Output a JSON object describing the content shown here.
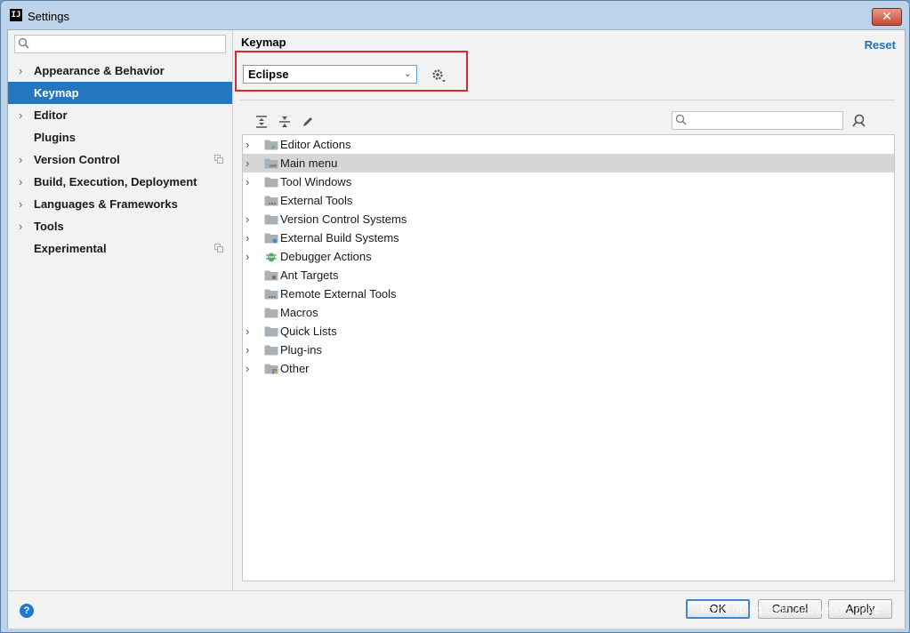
{
  "window": {
    "title": "Settings",
    "app_icon_text": "IJ",
    "close_glyph": "✕"
  },
  "sidebar": {
    "search": {
      "placeholder": "",
      "value": ""
    },
    "items": [
      {
        "label": "Appearance & Behavior",
        "expandable": true,
        "selected": false,
        "project_icon": false
      },
      {
        "label": "Keymap",
        "expandable": false,
        "selected": true,
        "project_icon": false
      },
      {
        "label": "Editor",
        "expandable": true,
        "selected": false,
        "project_icon": false
      },
      {
        "label": "Plugins",
        "expandable": false,
        "selected": false,
        "project_icon": false
      },
      {
        "label": "Version Control",
        "expandable": true,
        "selected": false,
        "project_icon": true
      },
      {
        "label": "Build, Execution, Deployment",
        "expandable": true,
        "selected": false,
        "project_icon": false
      },
      {
        "label": "Languages & Frameworks",
        "expandable": true,
        "selected": false,
        "project_icon": false
      },
      {
        "label": "Tools",
        "expandable": true,
        "selected": false,
        "project_icon": false
      },
      {
        "label": "Experimental",
        "expandable": false,
        "selected": false,
        "project_icon": true
      }
    ]
  },
  "main": {
    "breadcrumb": "Keymap",
    "reset_label": "Reset",
    "keymap_select": {
      "value": "Eclipse"
    },
    "toolbar_icons": [
      "expand-all-icon",
      "collapse-all-icon",
      "edit-icon"
    ],
    "filter": {
      "placeholder": "",
      "value": ""
    },
    "actions": [
      {
        "label": "Editor Actions",
        "expandable": true,
        "selected": false,
        "icon": "folder-edit-icon"
      },
      {
        "label": "Main menu",
        "expandable": true,
        "selected": true,
        "icon": "folder-menu-icon"
      },
      {
        "label": "Tool Windows",
        "expandable": true,
        "selected": false,
        "icon": "folder-icon"
      },
      {
        "label": "External Tools",
        "expandable": false,
        "selected": false,
        "icon": "folder-tools-icon"
      },
      {
        "label": "Version Control Systems",
        "expandable": true,
        "selected": false,
        "icon": "folder-icon"
      },
      {
        "label": "External Build Systems",
        "expandable": true,
        "selected": false,
        "icon": "folder-build-icon"
      },
      {
        "label": "Debugger Actions",
        "expandable": true,
        "selected": false,
        "icon": "bug-icon"
      },
      {
        "label": "Ant Targets",
        "expandable": false,
        "selected": false,
        "icon": "folder-ant-icon"
      },
      {
        "label": "Remote External Tools",
        "expandable": false,
        "selected": false,
        "icon": "folder-tools-icon"
      },
      {
        "label": "Macros",
        "expandable": false,
        "selected": false,
        "icon": "folder-icon"
      },
      {
        "label": "Quick Lists",
        "expandable": true,
        "selected": false,
        "icon": "folder-icon"
      },
      {
        "label": "Plug-ins",
        "expandable": true,
        "selected": false,
        "icon": "folder-icon"
      },
      {
        "label": "Other",
        "expandable": true,
        "selected": false,
        "icon": "folder-other-icon"
      }
    ]
  },
  "footer": {
    "help_glyph": "?",
    "ok_label": "OK",
    "cancel_label": "Cancel",
    "apply_label": "Apply"
  },
  "watermark": "https://blog.csdn.net/weixin_code",
  "colors": {
    "selection": "#2675bf",
    "link": "#2470b3",
    "highlight_box": "#e0282a"
  }
}
